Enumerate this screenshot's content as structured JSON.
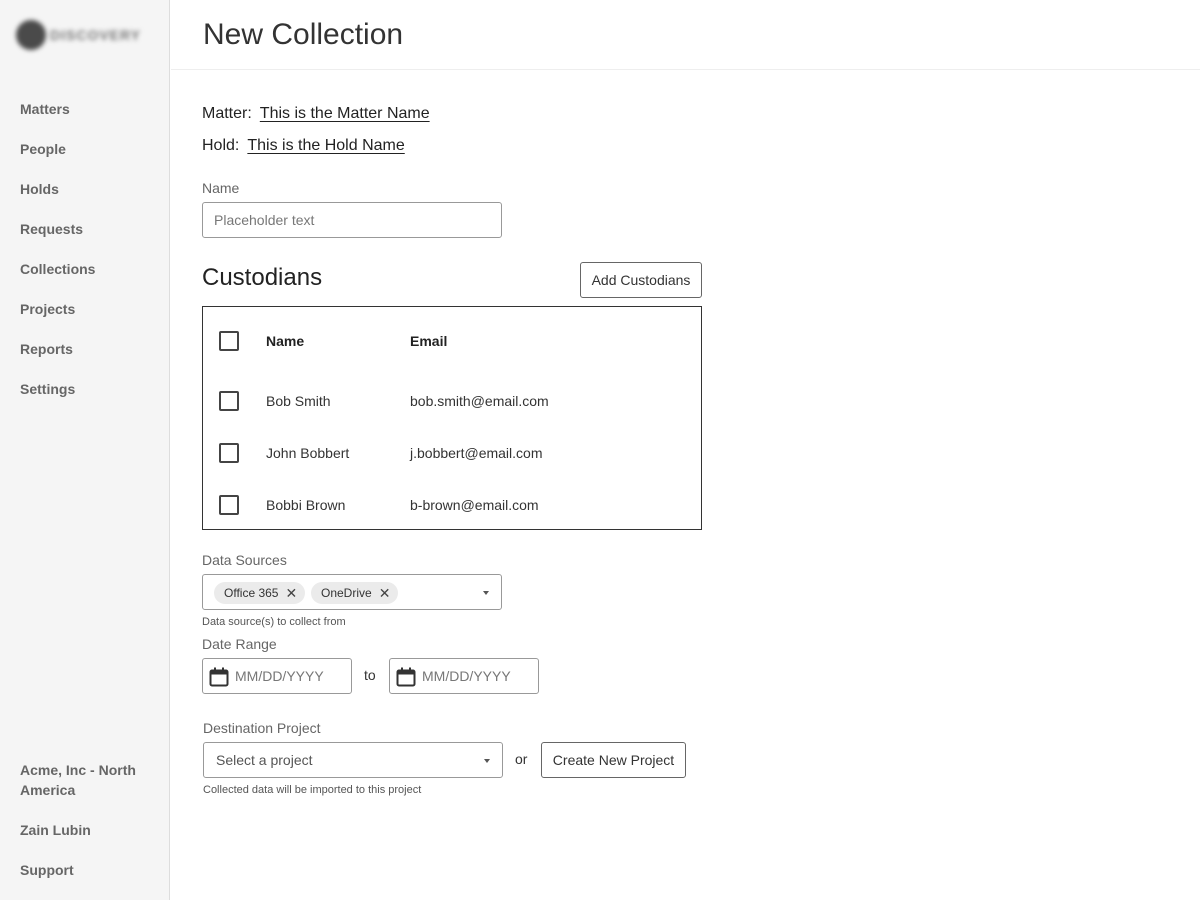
{
  "sidebar": {
    "logo_text": "DISCOVERY",
    "nav": [
      "Matters",
      "People",
      "Holds",
      "Requests",
      "Collections",
      "Projects",
      "Reports",
      "Settings"
    ],
    "account": "Acme, Inc - North America",
    "user": "Zain Lubin",
    "support": "Support"
  },
  "header": {
    "title": "New Collection"
  },
  "context": {
    "matter_label": "Matter:",
    "matter_value": "This is the Matter Name",
    "hold_label": "Hold:",
    "hold_value": "This is the Hold Name"
  },
  "name_field": {
    "label": "Name",
    "placeholder": "Placeholder text"
  },
  "custodians": {
    "title": "Custodians",
    "add_button": "Add Custodians",
    "columns": [
      "Name",
      "Email"
    ],
    "rows": [
      {
        "name": "Bob Smith",
        "email": "bob.smith@email.com",
        "checked": false
      },
      {
        "name": "John Bobbert",
        "email": "j.bobbert@email.com",
        "checked": false
      },
      {
        "name": "Bobbi Brown",
        "email": "b-brown@email.com",
        "checked": false
      }
    ]
  },
  "data_sources": {
    "label": "Data Sources",
    "selected": [
      "Office 365",
      "OneDrive"
    ],
    "helper": "Data source(s) to collect from"
  },
  "date_range": {
    "label": "Date Range",
    "start_placeholder": "MM/DD/YYYY",
    "separator": "to",
    "end_placeholder": "MM/DD/YYYY"
  },
  "destination": {
    "label": "Destination Project",
    "select_placeholder": "Select a project",
    "or_text": "or",
    "create_button": "Create New Project",
    "helper": "Collected data will be imported to this project"
  },
  "colors": {
    "sidebar_bg": "#f5f5f5",
    "border": "#999999",
    "chip_bg": "#ebebeb",
    "text": "#333333"
  }
}
